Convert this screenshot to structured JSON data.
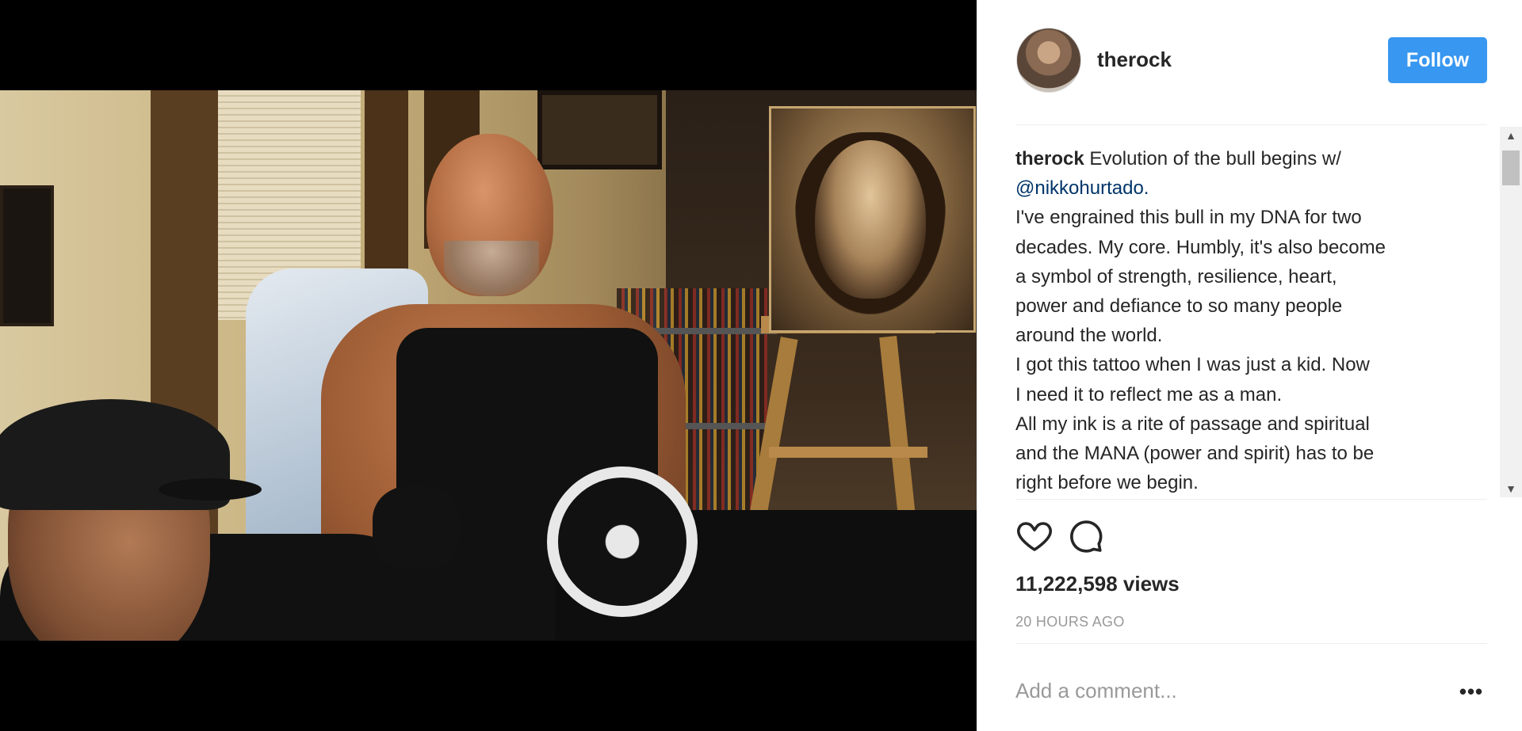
{
  "post": {
    "username": "therock",
    "follow_label": "Follow",
    "caption": {
      "author": "therock",
      "lines": [
        "Evolution of the bull begins w/",
        "@nikkohurtado.",
        "I've engrained this bull in my DNA for two",
        "decades. My core. Humbly, it's also become",
        "a symbol of strength, resilience, heart,",
        "power and defiance to so many people",
        "around the world.",
        "I got this tattoo when I was just a kid. Now",
        "I need it to reflect me as a man.",
        "All my ink is a rite of passage and spiritual",
        "and the MANA (power and spirit) has to be",
        "right before we begin."
      ]
    },
    "views": "11,222,598 views",
    "timestamp": "20 HOURS AGO",
    "comment_placeholder": "Add a comment...",
    "more_label": "•••"
  },
  "icons": {
    "like": "heart-icon",
    "comment": "comment-bubble-icon",
    "scroll_up": "▲",
    "scroll_down": "▼"
  },
  "colors": {
    "accent": "#3897f0",
    "mention": "#003569",
    "muted": "#999999",
    "text": "#262626"
  }
}
